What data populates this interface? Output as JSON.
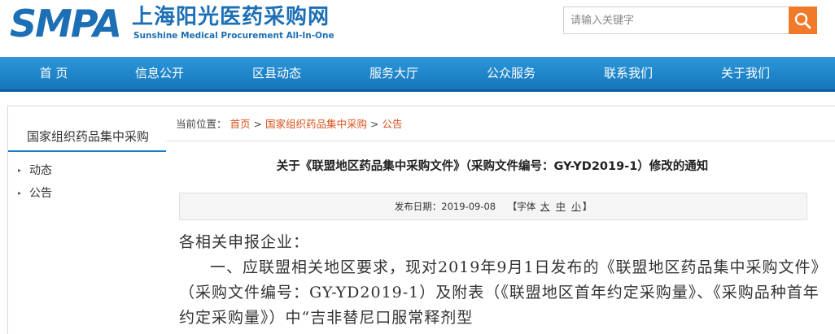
{
  "header": {
    "logo": {
      "abbr": "SMPA",
      "name_cn": "上海阳光医药采购网",
      "name_en": "Sunshine Medical Procurement All-In-One"
    },
    "search": {
      "placeholder": "请输入关键字",
      "icon": "search-icon"
    }
  },
  "nav": {
    "items": [
      "首 页",
      "信息公开",
      "区县动态",
      "服务大厅",
      "公众服务",
      "联系我们",
      "关于我们"
    ]
  },
  "sidebar": {
    "title": "国家组织药品集中采购",
    "items": [
      "动态",
      "公告"
    ]
  },
  "breadcrumb": {
    "prefix": "当前位置：",
    "links": [
      "首页",
      "国家组织药品集中采购",
      "公告"
    ],
    "separator": ">"
  },
  "article": {
    "title": "关于《联盟地区药品集中采购文件》（采购文件编号：GY-YD2019-1）修改的通知",
    "meta": {
      "date_label": "发布日期：",
      "date": "2019-09-08",
      "font_label": "【字体",
      "font_sizes": [
        "大",
        "中",
        "小"
      ],
      "font_close": "】"
    },
    "body": {
      "greeting": "各相关申报企业：",
      "paragraph1": "一、应联盟相关地区要求，现对2019年9月1日发布的《联盟地区药品集中采购文件》（采购文件编号：GY-YD2019-1）及附表（《联盟地区首年约定采购量》、《采购品种首年约定采购量》）中“吉非替尼口服常释剂型"
    }
  },
  "colors": {
    "brand_blue": "#1c6fb5",
    "nav_blue": "#1e86cc",
    "search_orange": "#f07a2a",
    "link_orange": "#d9531e"
  }
}
